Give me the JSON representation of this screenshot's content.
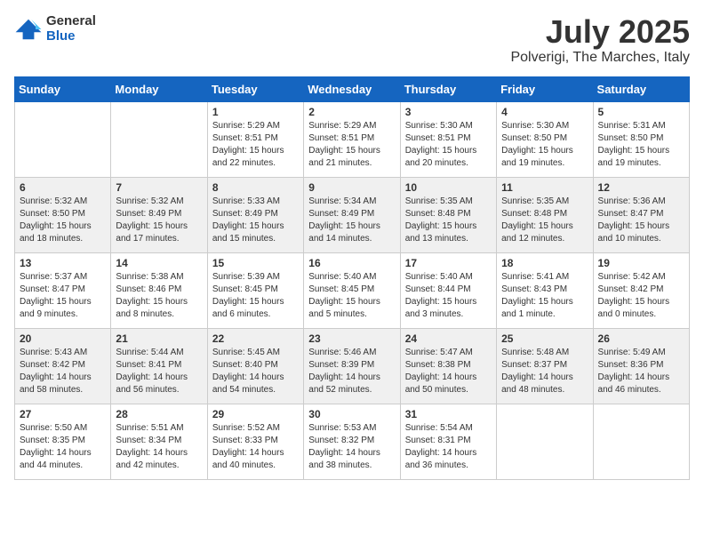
{
  "header": {
    "logo_general": "General",
    "logo_blue": "Blue",
    "month_title": "July 2025",
    "location": "Polverigi, The Marches, Italy"
  },
  "days_of_week": [
    "Sunday",
    "Monday",
    "Tuesday",
    "Wednesday",
    "Thursday",
    "Friday",
    "Saturday"
  ],
  "weeks": [
    [
      {
        "day": "",
        "info": ""
      },
      {
        "day": "",
        "info": ""
      },
      {
        "day": "1",
        "info": "Sunrise: 5:29 AM\nSunset: 8:51 PM\nDaylight: 15 hours and 22 minutes."
      },
      {
        "day": "2",
        "info": "Sunrise: 5:29 AM\nSunset: 8:51 PM\nDaylight: 15 hours and 21 minutes."
      },
      {
        "day": "3",
        "info": "Sunrise: 5:30 AM\nSunset: 8:51 PM\nDaylight: 15 hours and 20 minutes."
      },
      {
        "day": "4",
        "info": "Sunrise: 5:30 AM\nSunset: 8:50 PM\nDaylight: 15 hours and 19 minutes."
      },
      {
        "day": "5",
        "info": "Sunrise: 5:31 AM\nSunset: 8:50 PM\nDaylight: 15 hours and 19 minutes."
      }
    ],
    [
      {
        "day": "6",
        "info": "Sunrise: 5:32 AM\nSunset: 8:50 PM\nDaylight: 15 hours and 18 minutes."
      },
      {
        "day": "7",
        "info": "Sunrise: 5:32 AM\nSunset: 8:49 PM\nDaylight: 15 hours and 17 minutes."
      },
      {
        "day": "8",
        "info": "Sunrise: 5:33 AM\nSunset: 8:49 PM\nDaylight: 15 hours and 15 minutes."
      },
      {
        "day": "9",
        "info": "Sunrise: 5:34 AM\nSunset: 8:49 PM\nDaylight: 15 hours and 14 minutes."
      },
      {
        "day": "10",
        "info": "Sunrise: 5:35 AM\nSunset: 8:48 PM\nDaylight: 15 hours and 13 minutes."
      },
      {
        "day": "11",
        "info": "Sunrise: 5:35 AM\nSunset: 8:48 PM\nDaylight: 15 hours and 12 minutes."
      },
      {
        "day": "12",
        "info": "Sunrise: 5:36 AM\nSunset: 8:47 PM\nDaylight: 15 hours and 10 minutes."
      }
    ],
    [
      {
        "day": "13",
        "info": "Sunrise: 5:37 AM\nSunset: 8:47 PM\nDaylight: 15 hours and 9 minutes."
      },
      {
        "day": "14",
        "info": "Sunrise: 5:38 AM\nSunset: 8:46 PM\nDaylight: 15 hours and 8 minutes."
      },
      {
        "day": "15",
        "info": "Sunrise: 5:39 AM\nSunset: 8:45 PM\nDaylight: 15 hours and 6 minutes."
      },
      {
        "day": "16",
        "info": "Sunrise: 5:40 AM\nSunset: 8:45 PM\nDaylight: 15 hours and 5 minutes."
      },
      {
        "day": "17",
        "info": "Sunrise: 5:40 AM\nSunset: 8:44 PM\nDaylight: 15 hours and 3 minutes."
      },
      {
        "day": "18",
        "info": "Sunrise: 5:41 AM\nSunset: 8:43 PM\nDaylight: 15 hours and 1 minute."
      },
      {
        "day": "19",
        "info": "Sunrise: 5:42 AM\nSunset: 8:42 PM\nDaylight: 15 hours and 0 minutes."
      }
    ],
    [
      {
        "day": "20",
        "info": "Sunrise: 5:43 AM\nSunset: 8:42 PM\nDaylight: 14 hours and 58 minutes."
      },
      {
        "day": "21",
        "info": "Sunrise: 5:44 AM\nSunset: 8:41 PM\nDaylight: 14 hours and 56 minutes."
      },
      {
        "day": "22",
        "info": "Sunrise: 5:45 AM\nSunset: 8:40 PM\nDaylight: 14 hours and 54 minutes."
      },
      {
        "day": "23",
        "info": "Sunrise: 5:46 AM\nSunset: 8:39 PM\nDaylight: 14 hours and 52 minutes."
      },
      {
        "day": "24",
        "info": "Sunrise: 5:47 AM\nSunset: 8:38 PM\nDaylight: 14 hours and 50 minutes."
      },
      {
        "day": "25",
        "info": "Sunrise: 5:48 AM\nSunset: 8:37 PM\nDaylight: 14 hours and 48 minutes."
      },
      {
        "day": "26",
        "info": "Sunrise: 5:49 AM\nSunset: 8:36 PM\nDaylight: 14 hours and 46 minutes."
      }
    ],
    [
      {
        "day": "27",
        "info": "Sunrise: 5:50 AM\nSunset: 8:35 PM\nDaylight: 14 hours and 44 minutes."
      },
      {
        "day": "28",
        "info": "Sunrise: 5:51 AM\nSunset: 8:34 PM\nDaylight: 14 hours and 42 minutes."
      },
      {
        "day": "29",
        "info": "Sunrise: 5:52 AM\nSunset: 8:33 PM\nDaylight: 14 hours and 40 minutes."
      },
      {
        "day": "30",
        "info": "Sunrise: 5:53 AM\nSunset: 8:32 PM\nDaylight: 14 hours and 38 minutes."
      },
      {
        "day": "31",
        "info": "Sunrise: 5:54 AM\nSunset: 8:31 PM\nDaylight: 14 hours and 36 minutes."
      },
      {
        "day": "",
        "info": ""
      },
      {
        "day": "",
        "info": ""
      }
    ]
  ]
}
